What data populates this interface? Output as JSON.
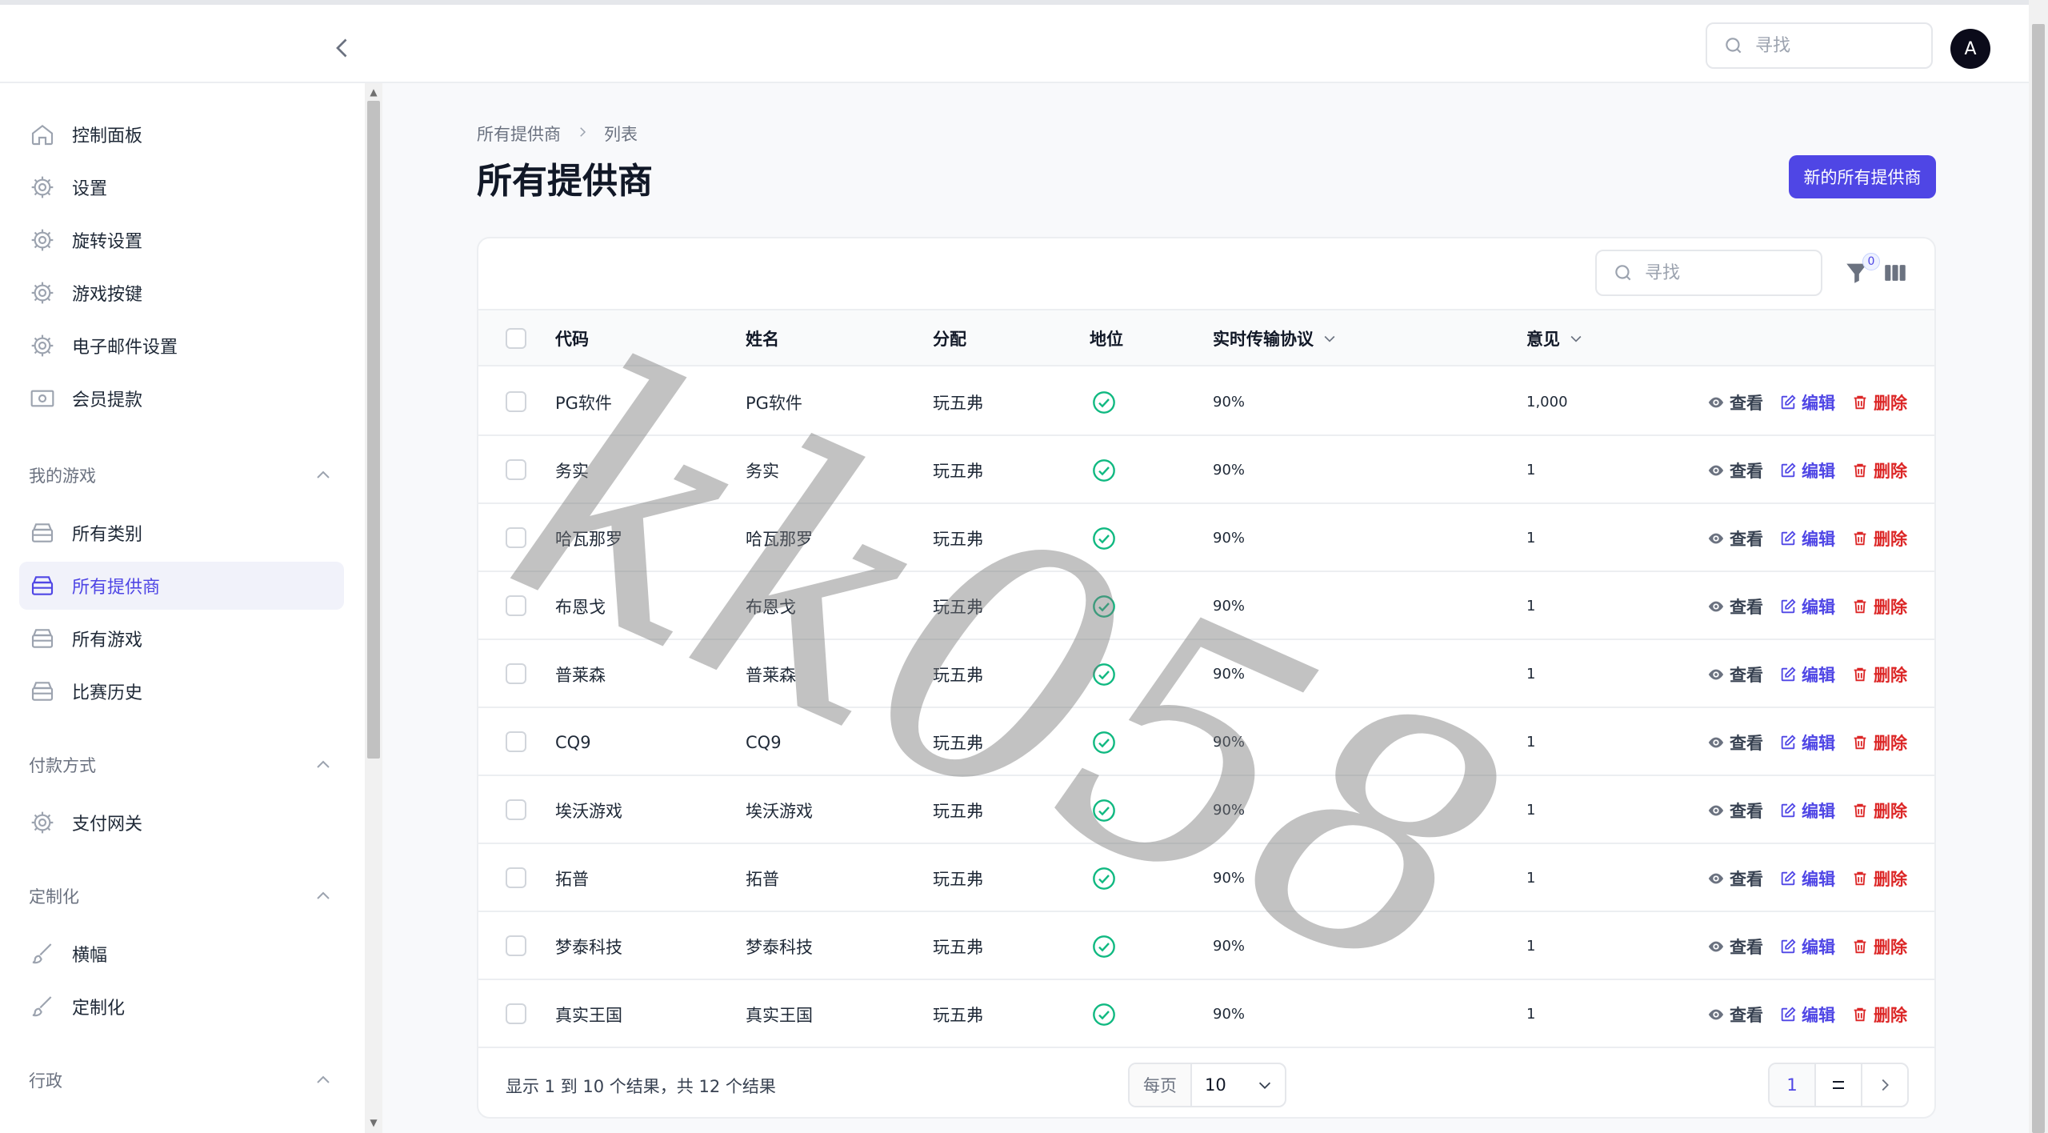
{
  "topbar": {
    "search_placeholder": "寻找",
    "avatar_initial": "A"
  },
  "sidebar": {
    "items": [
      {
        "label": "控制面板",
        "icon": "home-icon"
      },
      {
        "label": "设置",
        "icon": "gear-icon"
      },
      {
        "label": "旋转设置",
        "icon": "gear-icon"
      },
      {
        "label": "游戏按键",
        "icon": "gear-icon"
      },
      {
        "label": "电子邮件设置",
        "icon": "gear-icon"
      },
      {
        "label": "会员提款",
        "icon": "cash-icon"
      }
    ],
    "groups": [
      {
        "label": "我的游戏",
        "items": [
          {
            "label": "所有类别",
            "icon": "archive-icon"
          },
          {
            "label": "所有提供商",
            "icon": "archive-icon",
            "active": true
          },
          {
            "label": "所有游戏",
            "icon": "archive-icon"
          },
          {
            "label": "比赛历史",
            "icon": "archive-icon"
          }
        ]
      },
      {
        "label": "付款方式",
        "items": [
          {
            "label": "支付网关",
            "icon": "gear-icon"
          }
        ]
      },
      {
        "label": "定制化",
        "items": [
          {
            "label": "横幅",
            "icon": "brush-icon"
          },
          {
            "label": "定制化",
            "icon": "brush-icon"
          }
        ]
      },
      {
        "label": "行政",
        "items": []
      }
    ]
  },
  "breadcrumb": {
    "parent": "所有提供商",
    "current": "列表"
  },
  "page": {
    "title": "所有提供商",
    "new_button": "新的所有提供商"
  },
  "table": {
    "search_placeholder": "寻找",
    "filter_count": "0",
    "columns": [
      "代码",
      "姓名",
      "分配",
      "地位",
      "实时传输协议",
      "意见"
    ],
    "actions": {
      "view": "查看",
      "edit": "编辑",
      "delete": "删除"
    },
    "rows": [
      {
        "code": "PG软件",
        "name": "PG软件",
        "distribution": "玩五弗",
        "status": "active",
        "rtp": "90%",
        "views": "1,000"
      },
      {
        "code": "务实",
        "name": "务实",
        "distribution": "玩五弗",
        "status": "active",
        "rtp": "90%",
        "views": "1"
      },
      {
        "code": "哈瓦那罗",
        "name": "哈瓦那罗",
        "distribution": "玩五弗",
        "status": "active",
        "rtp": "90%",
        "views": "1"
      },
      {
        "code": "布恩戈",
        "name": "布恩戈",
        "distribution": "玩五弗",
        "status": "active",
        "rtp": "90%",
        "views": "1"
      },
      {
        "code": "普莱森",
        "name": "普莱森",
        "distribution": "玩五弗",
        "status": "active",
        "rtp": "90%",
        "views": "1"
      },
      {
        "code": "CQ9",
        "name": "CQ9",
        "distribution": "玩五弗",
        "status": "active",
        "rtp": "90%",
        "views": "1"
      },
      {
        "code": "埃沃游戏",
        "name": "埃沃游戏",
        "distribution": "玩五弗",
        "status": "active",
        "rtp": "90%",
        "views": "1"
      },
      {
        "code": "拓普",
        "name": "拓普",
        "distribution": "玩五弗",
        "status": "active",
        "rtp": "90%",
        "views": "1"
      },
      {
        "code": "梦泰科技",
        "name": "梦泰科技",
        "distribution": "玩五弗",
        "status": "active",
        "rtp": "90%",
        "views": "1"
      },
      {
        "code": "真实王国",
        "name": "真实王国",
        "distribution": "玩五弗",
        "status": "active",
        "rtp": "90%",
        "views": "1"
      }
    ],
    "footer": {
      "summary": "显示 1 到 10 个结果，共 12 个结果",
      "per_page_label": "每页",
      "per_page_value": "10",
      "current_page": "1"
    }
  },
  "watermark": "kk058",
  "colors": {
    "accent": "#4f46e5",
    "success": "#10b981",
    "danger": "#dc2626"
  }
}
